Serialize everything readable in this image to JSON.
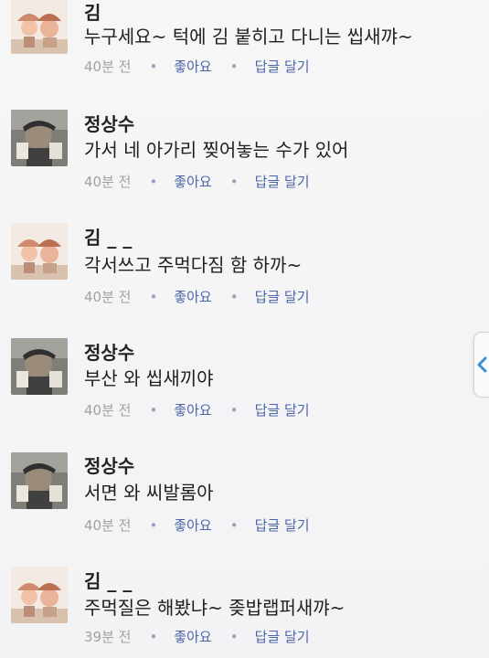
{
  "comments": [
    {
      "author": "김",
      "text": "누구세요~ 턱에 김 붙히고 다니는 씹새꺄~",
      "time": "40분 전",
      "like": "좋아요",
      "reply": "답글 달기",
      "avatar": "avatar-hat"
    },
    {
      "author": "정상수",
      "text": "가서 네 아가리 찢어놓는 수가 있어",
      "time": "40분 전",
      "like": "좋아요",
      "reply": "답글 달기",
      "avatar": "avatar-man"
    },
    {
      "author": "김 _ _",
      "text": "각서쓰고 주먹다짐 함 하까~",
      "time": "40분 전",
      "like": "좋아요",
      "reply": "답글 달기",
      "avatar": "avatar-hat"
    },
    {
      "author": "정상수",
      "text": "부산 와 씹새끼야",
      "time": "40분 전",
      "like": "좋아요",
      "reply": "답글 달기",
      "avatar": "avatar-man"
    },
    {
      "author": "정상수",
      "text": "서면 와 씨발롬아",
      "time": "40분 전",
      "like": "좋아요",
      "reply": "답글 달기",
      "avatar": "avatar-man"
    },
    {
      "author": "김 _ _",
      "text": "주먹질은 해봤냐~ 좆밥랩퍼새꺄~",
      "time": "39분 전",
      "like": "좋아요",
      "reply": "답글 달기",
      "avatar": "avatar-hat"
    }
  ],
  "side_tab": {
    "icon": "chevron-left-icon",
    "color": "#3b8fd3"
  },
  "colors": {
    "meta_gray": "#a1a1a1",
    "link_blue": "#4b66a8",
    "dot_blue": "#9aa4bf"
  }
}
